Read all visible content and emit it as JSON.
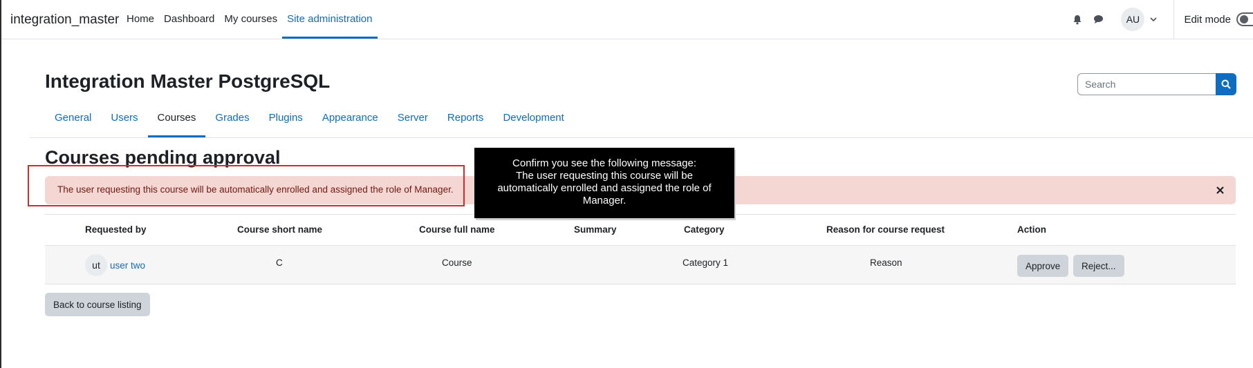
{
  "navbar": {
    "brand": "integration_master",
    "links": [
      {
        "label": "Home",
        "active": false
      },
      {
        "label": "Dashboard",
        "active": false
      },
      {
        "label": "My courses",
        "active": false
      },
      {
        "label": "Site administration",
        "active": true
      }
    ],
    "user_initials": "AU",
    "edit_mode_label": "Edit mode",
    "icons": [
      "bell-icon",
      "chat-icon",
      "chevron-down-icon"
    ]
  },
  "header": {
    "title": "Integration Master PostgreSQL",
    "search_placeholder": "Search"
  },
  "tabs": [
    {
      "label": "General",
      "active": false
    },
    {
      "label": "Users",
      "active": false
    },
    {
      "label": "Courses",
      "active": true
    },
    {
      "label": "Grades",
      "active": false
    },
    {
      "label": "Plugins",
      "active": false
    },
    {
      "label": "Appearance",
      "active": false
    },
    {
      "label": "Server",
      "active": false
    },
    {
      "label": "Reports",
      "active": false
    },
    {
      "label": "Development",
      "active": false
    }
  ],
  "main": {
    "heading": "Courses pending approval",
    "alert_text": "The user requesting this course will be automatically enrolled and assigned the role of Manager.",
    "table": {
      "headers": {
        "requested_by": "Requested by",
        "short_name": "Course short name",
        "full_name": "Course full name",
        "summary": "Summary",
        "category": "Category",
        "reason": "Reason for course request",
        "action": "Action"
      },
      "rows": [
        {
          "initials": "ut",
          "user": "user two",
          "short_name": "C",
          "full_name": "Course",
          "summary": "",
          "category": "Category 1",
          "reason": "Reason",
          "approve": "Approve",
          "reject": "Reject..."
        }
      ]
    },
    "back_button": "Back to course listing"
  },
  "callout": {
    "text": "Confirm you see the following message:\nThe user requesting this course will be\nautomatically enrolled and assigned the role of\nManager."
  },
  "colors": {
    "accent": "#0f6cbf",
    "alert_bg": "#f4d6d2",
    "alert_text": "#6e1a12",
    "highlight_border": "#d22b2b"
  }
}
